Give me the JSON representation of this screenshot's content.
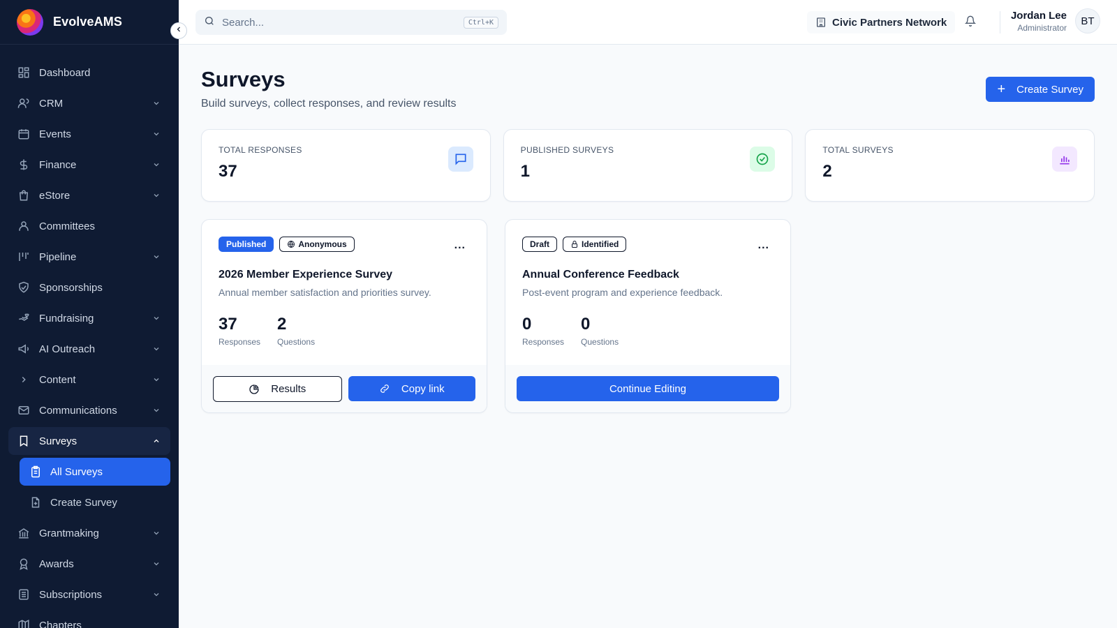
{
  "brand": {
    "name": "EvolveAMS",
    "logo": "gradient-orb-logo"
  },
  "sidebar": {
    "items": [
      {
        "label": "Dashboard",
        "icon": "grid-icon",
        "chevron": ""
      },
      {
        "label": "CRM",
        "icon": "users-icon",
        "chevron": "down"
      },
      {
        "label": "Events",
        "icon": "calendar-icon",
        "chevron": "down"
      },
      {
        "label": "Finance",
        "icon": "dollar-icon",
        "chevron": "down"
      },
      {
        "label": "eStore",
        "icon": "shopping-bag-icon",
        "chevron": "down"
      },
      {
        "label": "Committees",
        "icon": "user-group-icon",
        "chevron": ""
      },
      {
        "label": "Pipeline",
        "icon": "pipeline-icon",
        "chevron": "down"
      },
      {
        "label": "Sponsorships",
        "icon": "handshake-icon",
        "chevron": ""
      },
      {
        "label": "Fundraising",
        "icon": "hand-heart-icon",
        "chevron": "down"
      },
      {
        "label": "AI Outreach",
        "icon": "megaphone-icon",
        "chevron": "down"
      },
      {
        "label": "Content",
        "icon": "chevron-right-icon",
        "chevron": "down"
      },
      {
        "label": "Communications",
        "icon": "mail-icon",
        "chevron": "down"
      },
      {
        "label": "Surveys",
        "icon": "bookmark-icon",
        "chevron": "up"
      },
      {
        "label": "Grantmaking",
        "icon": "bank-icon",
        "chevron": "down"
      },
      {
        "label": "Awards",
        "icon": "award-icon",
        "chevron": "down"
      },
      {
        "label": "Subscriptions",
        "icon": "list-icon",
        "chevron": "down"
      },
      {
        "label": "Chapters",
        "icon": "map-icon",
        "chevron": ""
      }
    ],
    "surveys_sub": [
      {
        "label": "All Surveys",
        "icon": "clipboard-list-icon"
      },
      {
        "label": "Create Survey",
        "icon": "file-plus-icon"
      }
    ]
  },
  "topbar": {
    "search_placeholder": "Search...",
    "shortcut": "Ctrl+K",
    "org_name": "Civic Partners Network",
    "user_name": "Jordan Lee",
    "user_role": "Administrator",
    "avatar_initials": "BT"
  },
  "page": {
    "title": "Surveys",
    "subtitle": "Build surveys, collect responses, and review results",
    "create_label": "Create Survey"
  },
  "stats": [
    {
      "label": "TOTAL RESPONSES",
      "value": "37",
      "icon": "message-square-icon",
      "color": "#2563eb",
      "bg": "#dbeafe"
    },
    {
      "label": "PUBLISHED SURVEYS",
      "value": "1",
      "icon": "check-circle-icon",
      "color": "#16a34a",
      "bg": "#dcfce7"
    },
    {
      "label": "TOTAL SURVEYS",
      "value": "2",
      "icon": "bar-chart-icon",
      "color": "#9333ea",
      "bg": "#f3e8ff"
    }
  ],
  "surveys": [
    {
      "status": "Published",
      "privacy": "Anonymous",
      "title": "2026 Member Experience Survey",
      "description": "Annual member satisfaction and priorities survey.",
      "responses": "37",
      "responses_label": "Responses",
      "questions": "2",
      "questions_label": "Questions",
      "results_label": "Results",
      "copy_label": "Copy link",
      "more": "..."
    },
    {
      "status": "Draft",
      "privacy": "Identified",
      "title": "Annual Conference Feedback",
      "description": "Post-event program and experience feedback.",
      "responses": "0",
      "responses_label": "Responses",
      "questions": "0",
      "questions_label": "Questions",
      "continue_label": "Continue Editing",
      "more": "..."
    }
  ],
  "colors": {
    "primary": "#2563eb",
    "sidebar": "#0f1b33"
  }
}
